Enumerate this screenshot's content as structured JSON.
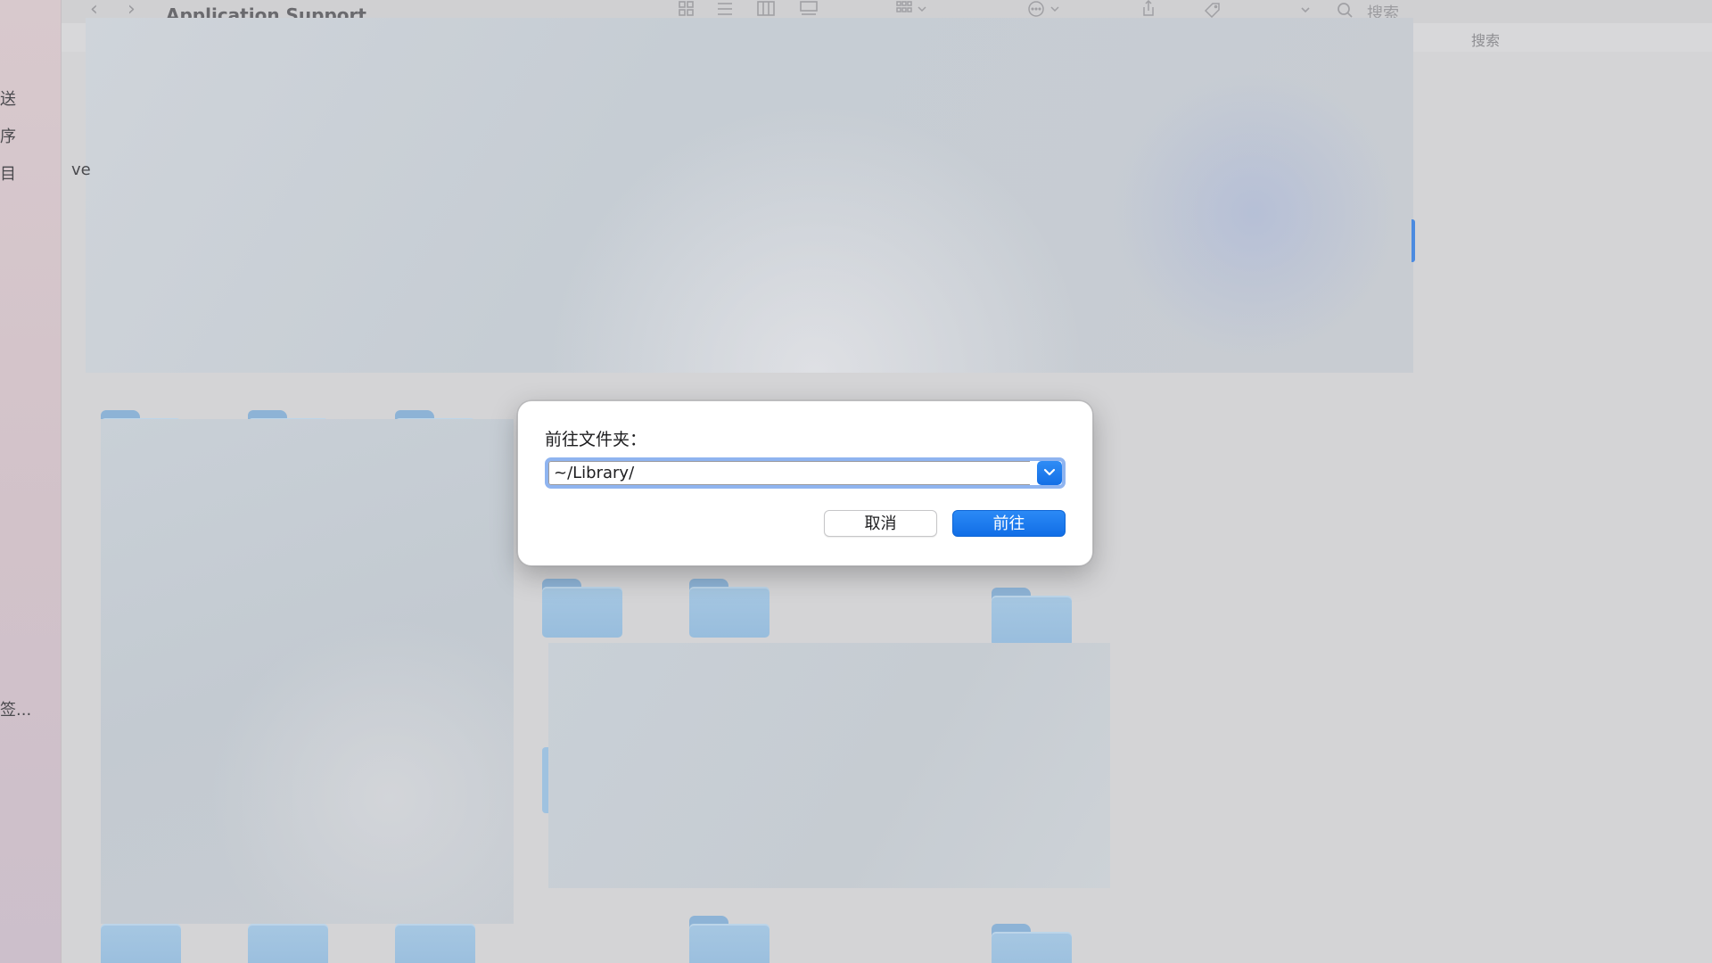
{
  "sidebar": {
    "items": [
      {
        "label": "送"
      },
      {
        "label": "序"
      },
      {
        "label": "目"
      },
      {
        "label": "签..."
      }
    ],
    "clipped_item": "ve"
  },
  "window": {
    "title": "Application Support",
    "search_placeholder": "搜索",
    "header_search_label": "搜索"
  },
  "dialog": {
    "label": "前往文件夹：",
    "path_value": "~/Library/",
    "cancel_label": "取消",
    "go_label": "前往"
  },
  "colors": {
    "accent": "#1473e6",
    "focus_ring": "#8fb4f0",
    "folder": "#9fc2e0"
  }
}
